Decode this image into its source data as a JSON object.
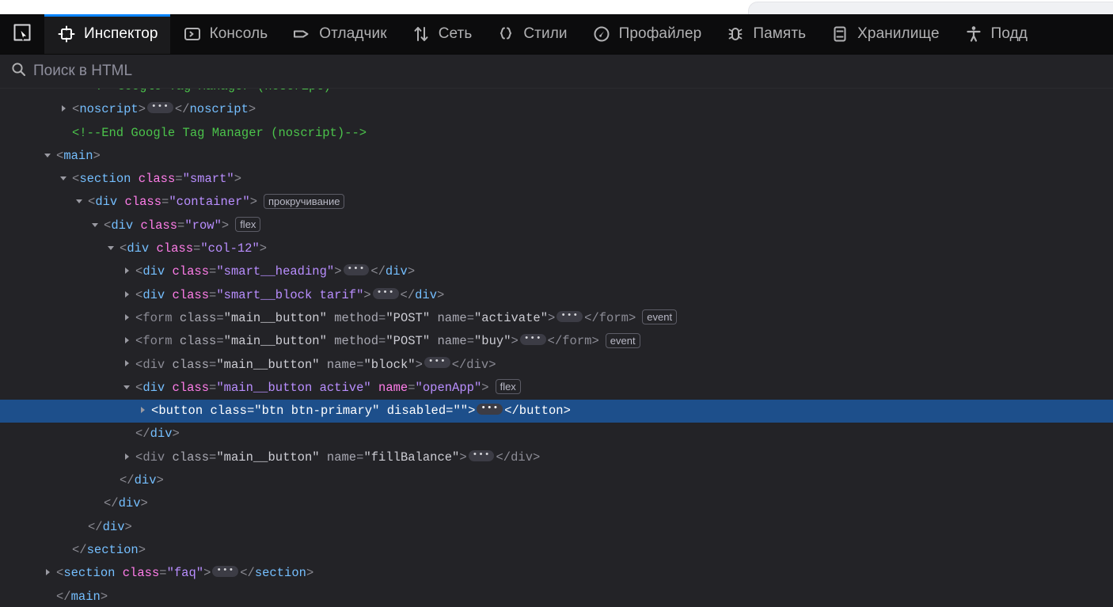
{
  "browser": {
    "tab_strip_present": true
  },
  "devtools": {
    "picker_icon": "element-picker-icon",
    "tabs": [
      {
        "label": "Инспектор",
        "icon": "inspector-icon",
        "selected": true
      },
      {
        "label": "Консоль",
        "icon": "console-icon",
        "selected": false
      },
      {
        "label": "Отладчик",
        "icon": "debugger-icon",
        "selected": false
      },
      {
        "label": "Сеть",
        "icon": "network-icon",
        "selected": false
      },
      {
        "label": "Стили",
        "icon": "style-editor-icon",
        "selected": false
      },
      {
        "label": "Профайлер",
        "icon": "performance-icon",
        "selected": false
      },
      {
        "label": "Память",
        "icon": "memory-icon",
        "selected": false
      },
      {
        "label": "Хранилище",
        "icon": "storage-icon",
        "selected": false
      },
      {
        "label": "Подд",
        "icon": "accessibility-icon",
        "selected": false
      }
    ],
    "accent_color": "#0a84ff",
    "selected_row_color": "#1d4f8b"
  },
  "search": {
    "placeholder": "Поиск в HTML",
    "value": "",
    "icon": "search-icon"
  },
  "markup": {
    "rows": [
      {
        "indent": 4,
        "twisty": "none",
        "clipped": true,
        "parts": [
          {
            "cls": "c-comment",
            "t": "<!--Google Tag Manager (noscript)-->"
          }
        ]
      },
      {
        "indent": 3,
        "twisty": "closed",
        "parts": [
          {
            "cls": "c-bracket",
            "t": "<"
          },
          {
            "cls": "c-tag",
            "t": "noscript"
          },
          {
            "cls": "c-bracket",
            "t": ">"
          },
          {
            "cls": "ellipsis",
            "t": "•••"
          },
          {
            "cls": "c-bracket",
            "t": "</"
          },
          {
            "cls": "c-tag",
            "t": "noscript"
          },
          {
            "cls": "c-bracket",
            "t": ">"
          }
        ]
      },
      {
        "indent": 3,
        "twisty": "none",
        "parts": [
          {
            "cls": "c-comment",
            "t": "<!--End Google Tag Manager (noscript)-->"
          }
        ]
      },
      {
        "indent": 2,
        "twisty": "open",
        "parts": [
          {
            "cls": "c-bracket",
            "t": "<"
          },
          {
            "cls": "c-tag",
            "t": "main"
          },
          {
            "cls": "c-bracket",
            "t": ">"
          }
        ]
      },
      {
        "indent": 3,
        "twisty": "open",
        "parts": [
          {
            "cls": "c-bracket",
            "t": "<"
          },
          {
            "cls": "c-tag",
            "t": "section"
          },
          {
            "cls": "c-sp",
            "t": " "
          },
          {
            "cls": "c-attr",
            "t": "class"
          },
          {
            "cls": "c-eq",
            "t": "="
          },
          {
            "cls": "c-val",
            "t": "\"smart\""
          },
          {
            "cls": "c-bracket",
            "t": ">"
          }
        ]
      },
      {
        "indent": 4,
        "twisty": "open",
        "parts": [
          {
            "cls": "c-bracket",
            "t": "<"
          },
          {
            "cls": "c-tag",
            "t": "div"
          },
          {
            "cls": "c-sp",
            "t": " "
          },
          {
            "cls": "c-attr",
            "t": "class"
          },
          {
            "cls": "c-eq",
            "t": "="
          },
          {
            "cls": "c-val",
            "t": "\"container\""
          },
          {
            "cls": "c-bracket",
            "t": ">"
          },
          {
            "cls": "badge",
            "t": "прокручивание"
          }
        ]
      },
      {
        "indent": 5,
        "twisty": "open",
        "parts": [
          {
            "cls": "c-bracket",
            "t": "<"
          },
          {
            "cls": "c-tag",
            "t": "div"
          },
          {
            "cls": "c-sp",
            "t": " "
          },
          {
            "cls": "c-attr",
            "t": "class"
          },
          {
            "cls": "c-eq",
            "t": "="
          },
          {
            "cls": "c-val",
            "t": "\"row\""
          },
          {
            "cls": "c-bracket",
            "t": ">"
          },
          {
            "cls": "badge",
            "t": "flex"
          }
        ]
      },
      {
        "indent": 6,
        "twisty": "open",
        "parts": [
          {
            "cls": "c-bracket",
            "t": "<"
          },
          {
            "cls": "c-tag",
            "t": "div"
          },
          {
            "cls": "c-sp",
            "t": " "
          },
          {
            "cls": "c-attr",
            "t": "class"
          },
          {
            "cls": "c-eq",
            "t": "="
          },
          {
            "cls": "c-val",
            "t": "\"col-12\""
          },
          {
            "cls": "c-bracket",
            "t": ">"
          }
        ]
      },
      {
        "indent": 7,
        "twisty": "closed",
        "parts": [
          {
            "cls": "c-bracket",
            "t": "<"
          },
          {
            "cls": "c-tag",
            "t": "div"
          },
          {
            "cls": "c-sp",
            "t": " "
          },
          {
            "cls": "c-attr",
            "t": "class"
          },
          {
            "cls": "c-eq",
            "t": "="
          },
          {
            "cls": "c-val",
            "t": "\"smart__heading\""
          },
          {
            "cls": "c-bracket",
            "t": ">"
          },
          {
            "cls": "ellipsis",
            "t": "•••"
          },
          {
            "cls": "c-bracket",
            "t": "</"
          },
          {
            "cls": "c-tag",
            "t": "div"
          },
          {
            "cls": "c-bracket",
            "t": ">"
          }
        ]
      },
      {
        "indent": 7,
        "twisty": "closed",
        "parts": [
          {
            "cls": "c-bracket",
            "t": "<"
          },
          {
            "cls": "c-tag",
            "t": "div"
          },
          {
            "cls": "c-sp",
            "t": " "
          },
          {
            "cls": "c-attr",
            "t": "class"
          },
          {
            "cls": "c-eq",
            "t": "="
          },
          {
            "cls": "c-val",
            "t": "\"smart__block tarif\""
          },
          {
            "cls": "c-bracket",
            "t": ">"
          },
          {
            "cls": "ellipsis",
            "t": "•••"
          },
          {
            "cls": "c-bracket",
            "t": "</"
          },
          {
            "cls": "c-tag",
            "t": "div"
          },
          {
            "cls": "c-bracket",
            "t": ">"
          }
        ]
      },
      {
        "indent": 7,
        "twisty": "closed",
        "dim": true,
        "parts": [
          {
            "cls": "c-dim",
            "t": "<"
          },
          {
            "cls": "c-dim",
            "t": "form"
          },
          {
            "cls": "c-sp",
            "t": " "
          },
          {
            "cls": "c-dim-attr",
            "t": "class"
          },
          {
            "cls": "c-dim",
            "t": "="
          },
          {
            "cls": "c-dim-val",
            "t": "\"main__button\""
          },
          {
            "cls": "c-sp",
            "t": " "
          },
          {
            "cls": "c-dim-attr",
            "t": "method"
          },
          {
            "cls": "c-dim",
            "t": "="
          },
          {
            "cls": "c-dim-val",
            "t": "\"POST\""
          },
          {
            "cls": "c-sp",
            "t": " "
          },
          {
            "cls": "c-dim-attr",
            "t": "name"
          },
          {
            "cls": "c-dim",
            "t": "="
          },
          {
            "cls": "c-dim-val",
            "t": "\"activate\""
          },
          {
            "cls": "c-dim",
            "t": ">"
          },
          {
            "cls": "ellipsis",
            "t": "•••"
          },
          {
            "cls": "c-dim",
            "t": "</form>"
          },
          {
            "cls": "badge",
            "t": "event"
          }
        ]
      },
      {
        "indent": 7,
        "twisty": "closed",
        "dim": true,
        "parts": [
          {
            "cls": "c-dim",
            "t": "<"
          },
          {
            "cls": "c-dim",
            "t": "form"
          },
          {
            "cls": "c-sp",
            "t": " "
          },
          {
            "cls": "c-dim-attr",
            "t": "class"
          },
          {
            "cls": "c-dim",
            "t": "="
          },
          {
            "cls": "c-dim-val",
            "t": "\"main__button\""
          },
          {
            "cls": "c-sp",
            "t": " "
          },
          {
            "cls": "c-dim-attr",
            "t": "method"
          },
          {
            "cls": "c-dim",
            "t": "="
          },
          {
            "cls": "c-dim-val",
            "t": "\"POST\""
          },
          {
            "cls": "c-sp",
            "t": " "
          },
          {
            "cls": "c-dim-attr",
            "t": "name"
          },
          {
            "cls": "c-dim",
            "t": "="
          },
          {
            "cls": "c-dim-val",
            "t": "\"buy\""
          },
          {
            "cls": "c-dim",
            "t": ">"
          },
          {
            "cls": "ellipsis",
            "t": "•••"
          },
          {
            "cls": "c-dim",
            "t": "</form>"
          },
          {
            "cls": "badge",
            "t": "event"
          }
        ]
      },
      {
        "indent": 7,
        "twisty": "closed",
        "dim": true,
        "parts": [
          {
            "cls": "c-dim",
            "t": "<"
          },
          {
            "cls": "c-dim",
            "t": "div"
          },
          {
            "cls": "c-sp",
            "t": " "
          },
          {
            "cls": "c-dim-attr",
            "t": "class"
          },
          {
            "cls": "c-dim",
            "t": "="
          },
          {
            "cls": "c-dim-val",
            "t": "\"main__button\""
          },
          {
            "cls": "c-sp",
            "t": " "
          },
          {
            "cls": "c-dim-attr",
            "t": "name"
          },
          {
            "cls": "c-dim",
            "t": "="
          },
          {
            "cls": "c-dim-val",
            "t": "\"block\""
          },
          {
            "cls": "c-dim",
            "t": ">"
          },
          {
            "cls": "ellipsis",
            "t": "•••"
          },
          {
            "cls": "c-dim",
            "t": "</div>"
          }
        ]
      },
      {
        "indent": 7,
        "twisty": "open",
        "parts": [
          {
            "cls": "c-bracket",
            "t": "<"
          },
          {
            "cls": "c-tag",
            "t": "div"
          },
          {
            "cls": "c-sp",
            "t": " "
          },
          {
            "cls": "c-attr",
            "t": "class"
          },
          {
            "cls": "c-eq",
            "t": "="
          },
          {
            "cls": "c-val",
            "t": "\"main__button active\""
          },
          {
            "cls": "c-sp",
            "t": " "
          },
          {
            "cls": "c-attr",
            "t": "name"
          },
          {
            "cls": "c-eq",
            "t": "="
          },
          {
            "cls": "c-val",
            "t": "\"openApp\""
          },
          {
            "cls": "c-bracket",
            "t": ">"
          },
          {
            "cls": "badge",
            "t": "flex"
          }
        ]
      },
      {
        "indent": 8,
        "twisty": "closed",
        "selected": true,
        "parts": [
          {
            "cls": "c-bracket",
            "t": "<"
          },
          {
            "cls": "c-tag",
            "t": "button"
          },
          {
            "cls": "c-sp",
            "t": " "
          },
          {
            "cls": "c-attr",
            "t": "class"
          },
          {
            "cls": "c-eq",
            "t": "="
          },
          {
            "cls": "c-val",
            "t": "\"btn btn-primary\""
          },
          {
            "cls": "c-sp",
            "t": " "
          },
          {
            "cls": "c-attr",
            "t": "disabled"
          },
          {
            "cls": "c-eq",
            "t": "="
          },
          {
            "cls": "c-val",
            "t": "\"\""
          },
          {
            "cls": "c-bracket",
            "t": ">"
          },
          {
            "cls": "ellipsis",
            "t": "•••"
          },
          {
            "cls": "c-bracket",
            "t": "</"
          },
          {
            "cls": "c-tag",
            "t": "button"
          },
          {
            "cls": "c-bracket",
            "t": ">"
          }
        ]
      },
      {
        "indent": 7,
        "twisty": "none",
        "parts": [
          {
            "cls": "c-bracket",
            "t": "</"
          },
          {
            "cls": "c-tag",
            "t": "div"
          },
          {
            "cls": "c-bracket",
            "t": ">"
          }
        ]
      },
      {
        "indent": 7,
        "twisty": "closed",
        "dim": true,
        "parts": [
          {
            "cls": "c-dim",
            "t": "<"
          },
          {
            "cls": "c-dim",
            "t": "div"
          },
          {
            "cls": "c-sp",
            "t": " "
          },
          {
            "cls": "c-dim-attr",
            "t": "class"
          },
          {
            "cls": "c-dim",
            "t": "="
          },
          {
            "cls": "c-dim-val",
            "t": "\"main__button\""
          },
          {
            "cls": "c-sp",
            "t": " "
          },
          {
            "cls": "c-dim-attr",
            "t": "name"
          },
          {
            "cls": "c-dim",
            "t": "="
          },
          {
            "cls": "c-dim-val",
            "t": "\"fillBalance\""
          },
          {
            "cls": "c-dim",
            "t": ">"
          },
          {
            "cls": "ellipsis",
            "t": "•••"
          },
          {
            "cls": "c-dim",
            "t": "</div>"
          }
        ]
      },
      {
        "indent": 6,
        "twisty": "none",
        "parts": [
          {
            "cls": "c-bracket",
            "t": "</"
          },
          {
            "cls": "c-tag",
            "t": "div"
          },
          {
            "cls": "c-bracket",
            "t": ">"
          }
        ]
      },
      {
        "indent": 5,
        "twisty": "none",
        "parts": [
          {
            "cls": "c-bracket",
            "t": "</"
          },
          {
            "cls": "c-tag",
            "t": "div"
          },
          {
            "cls": "c-bracket",
            "t": ">"
          }
        ]
      },
      {
        "indent": 4,
        "twisty": "none",
        "parts": [
          {
            "cls": "c-bracket",
            "t": "</"
          },
          {
            "cls": "c-tag",
            "t": "div"
          },
          {
            "cls": "c-bracket",
            "t": ">"
          }
        ]
      },
      {
        "indent": 3,
        "twisty": "none",
        "parts": [
          {
            "cls": "c-bracket",
            "t": "</"
          },
          {
            "cls": "c-tag",
            "t": "section"
          },
          {
            "cls": "c-bracket",
            "t": ">"
          }
        ]
      },
      {
        "indent": 2,
        "twisty": "closed",
        "parts": [
          {
            "cls": "c-bracket",
            "t": "<"
          },
          {
            "cls": "c-tag",
            "t": "section"
          },
          {
            "cls": "c-sp",
            "t": " "
          },
          {
            "cls": "c-attr",
            "t": "class"
          },
          {
            "cls": "c-eq",
            "t": "="
          },
          {
            "cls": "c-val",
            "t": "\"faq\""
          },
          {
            "cls": "c-bracket",
            "t": ">"
          },
          {
            "cls": "ellipsis",
            "t": "•••"
          },
          {
            "cls": "c-bracket",
            "t": "</"
          },
          {
            "cls": "c-tag",
            "t": "section"
          },
          {
            "cls": "c-bracket",
            "t": ">"
          }
        ]
      },
      {
        "indent": 2,
        "twisty": "none",
        "parts": [
          {
            "cls": "c-bracket",
            "t": "</"
          },
          {
            "cls": "c-tag",
            "t": "main"
          },
          {
            "cls": "c-bracket",
            "t": ">"
          }
        ]
      }
    ]
  }
}
